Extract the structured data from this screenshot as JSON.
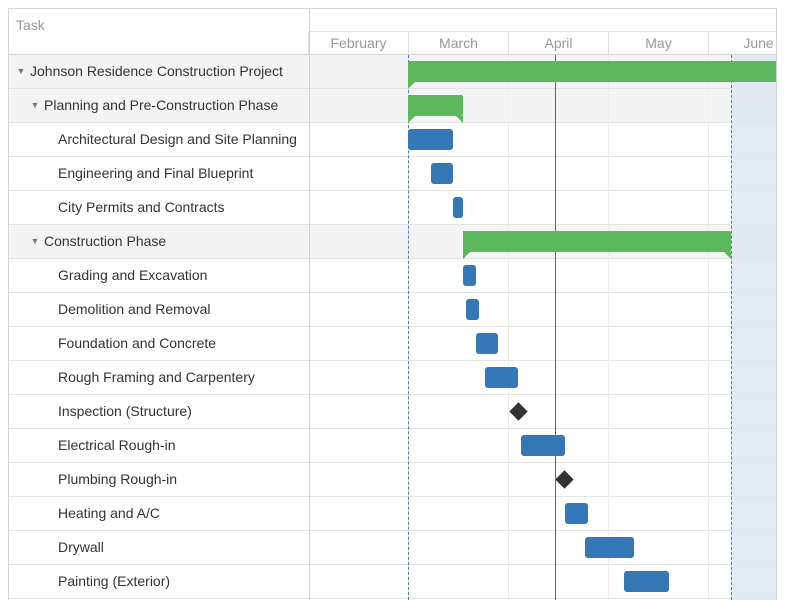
{
  "grid": {
    "header": "Task"
  },
  "timeline": {
    "months": [
      "February",
      "March",
      "April",
      "May",
      "June"
    ]
  },
  "colors": {
    "task": "#3478b8",
    "project": "#5cb85c",
    "milestone": "#333333",
    "today": "#e03030",
    "grid_line": "#ececec",
    "highlight": "#dde8f2"
  },
  "tasks": [
    {
      "label": "Johnson Residence Construction Project",
      "kind": "project",
      "level": 0,
      "expanded": true,
      "start": "Mar 01",
      "end": "Jun 30"
    },
    {
      "label": "Planning and Pre-Construction Phase",
      "kind": "project",
      "level": 1,
      "expanded": true,
      "start": "Mar 01",
      "end": "Mar 18"
    },
    {
      "label": "Architectural Design and Site Planning",
      "kind": "task",
      "level": 2,
      "start": "Mar 01",
      "end": "Mar 15"
    },
    {
      "label": "Engineering and Final Blueprint",
      "kind": "task",
      "level": 2,
      "start": "Mar 08",
      "end": "Mar 15"
    },
    {
      "label": "City Permits and Contracts",
      "kind": "task",
      "level": 2,
      "start": "Mar 15",
      "end": "Mar 18"
    },
    {
      "label": "Construction Phase",
      "kind": "project",
      "level": 1,
      "expanded": true,
      "start": "Mar 18",
      "end": "Jun 08"
    },
    {
      "label": "Grading and Excavation",
      "kind": "task",
      "level": 2,
      "start": "Mar 18",
      "end": "Mar 22"
    },
    {
      "label": "Demolition and Removal",
      "kind": "task",
      "level": 2,
      "start": "Mar 19",
      "end": "Mar 23"
    },
    {
      "label": "Foundation and Concrete",
      "kind": "task",
      "level": 2,
      "start": "Mar 22",
      "end": "Mar 29"
    },
    {
      "label": "Rough Framing and Carpentery",
      "kind": "task",
      "level": 2,
      "start": "Mar 25",
      "end": "Apr 04"
    },
    {
      "label": "Inspection (Structure)",
      "kind": "milestone",
      "level": 2,
      "start": "Apr 04"
    },
    {
      "label": "Electrical Rough-in",
      "kind": "task",
      "level": 2,
      "start": "Apr 05",
      "end": "Apr 18"
    },
    {
      "label": "Plumbing Rough-in",
      "kind": "milestone",
      "level": 2,
      "start": "Apr 18"
    },
    {
      "label": "Heating and A/C",
      "kind": "task",
      "level": 2,
      "start": "Apr 18",
      "end": "Apr 25"
    },
    {
      "label": "Drywall",
      "kind": "task",
      "level": 2,
      "start": "Apr 24",
      "end": "May 09"
    },
    {
      "label": "Painting (Exterior)",
      "kind": "task",
      "level": 2,
      "start": "May 06",
      "end": "May 20"
    }
  ]
}
